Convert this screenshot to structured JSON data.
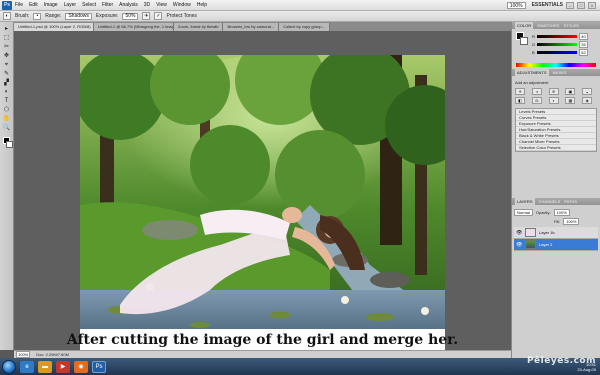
{
  "app": {
    "logo": "Ps",
    "menu": [
      "File",
      "Edit",
      "Image",
      "Layer",
      "Select",
      "Filter",
      "Analysis",
      "3D",
      "View",
      "Window",
      "Help"
    ],
    "zoom_display": "100%",
    "workspace": "ESSENTIALS"
  },
  "options": {
    "brush_label": "Brush:",
    "range_label": "Range:",
    "range_value": "Shadows",
    "exposure_label": "Exposure:",
    "exposure_value": "50%",
    "protect_label": "Protect Tones"
  },
  "tabs": [
    "Untitled-1.psd @ 100% (Layer 2, RGB/8)",
    "Untitled-1 @ 66.7% (Mhmgnng the, 1 images/ forest...",
    "Zoom, forest by thewlb",
    "Bronzes_bru by samurai...",
    "Collect by copy group..."
  ],
  "tools": [
    "▸",
    "⬚",
    "✂",
    "✥",
    "⌖",
    "✎",
    "▞",
    "◐",
    "T",
    "⬠",
    "✋",
    "🔍"
  ],
  "canvas": {
    "caption": "After cutting the image of the girl and merge her."
  },
  "status": {
    "zoom": "100%",
    "doc": "Doc: 2.29M/7.60M"
  },
  "color_panel": {
    "tabs": [
      "COLOR",
      "SWATCHES",
      "STYLES"
    ],
    "rows": [
      {
        "label": "R",
        "value": "40"
      },
      {
        "label": "G",
        "value": "35"
      },
      {
        "label": "B",
        "value": "52"
      }
    ]
  },
  "adjustments": {
    "tabs": [
      "ADJUSTMENTS",
      "MASKS"
    ],
    "title": "Add an adjustment",
    "icons": [
      "☀",
      "◑",
      "≋",
      "▣",
      "◒",
      "◧",
      "⚖",
      "◐",
      "▦",
      "◈"
    ],
    "presets": [
      "Levels Presets",
      "Curves Presets",
      "Exposure Presets",
      "Hue/Saturation Presets",
      "Black & White Presets",
      "Channel Mixer Presets",
      "Selective Color Presets"
    ]
  },
  "layers": {
    "tabs": [
      "LAYERS",
      "CHANNELS",
      "PATHS"
    ],
    "blend": "Normal",
    "opacity_label": "Opacity:",
    "opacity": "100%",
    "fill_label": "Fill:",
    "fill": "100%",
    "items": [
      {
        "name": "Layer 1b",
        "selected": false
      },
      {
        "name": "Layer 2",
        "selected": true
      }
    ]
  },
  "taskbar": {
    "time": "10:51",
    "date": "23-Aug-09"
  },
  "watermark": "Pêleyes.com"
}
